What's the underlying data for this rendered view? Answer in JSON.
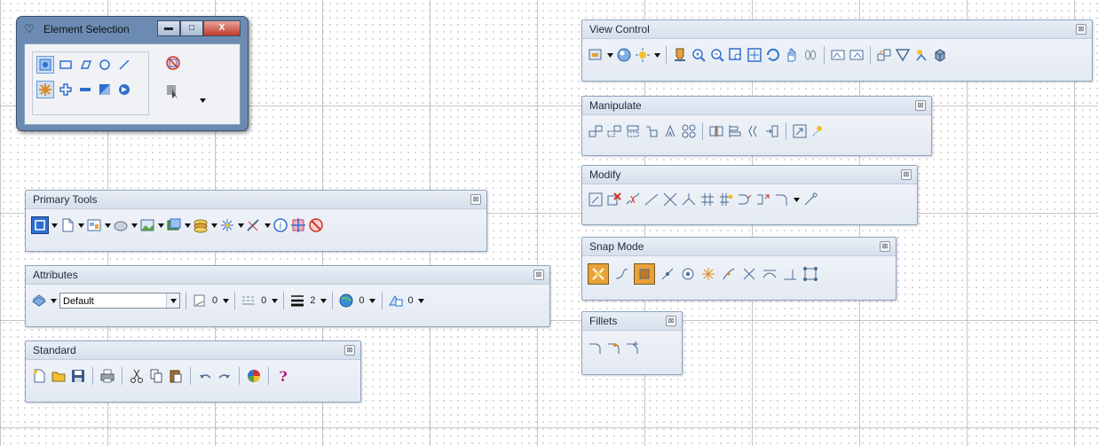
{
  "element_selection": {
    "title": "Element Selection",
    "minimize_icon": "minimize-icon",
    "maximize_icon": "maximize-icon",
    "close_label": "X"
  },
  "view_control": {
    "title": "View Control"
  },
  "manipulate": {
    "title": "Manipulate"
  },
  "modify": {
    "title": "Modify"
  },
  "snap_mode": {
    "title": "Snap Mode"
  },
  "fillets": {
    "title": "Fillets"
  },
  "primary_tools": {
    "title": "Primary Tools"
  },
  "attributes": {
    "title": "Attributes",
    "level_value": "Default",
    "color_value": "0",
    "style_value": "0",
    "weight_value": "2",
    "transparency_value": "0",
    "priority_value": "0"
  },
  "standard": {
    "title": "Standard"
  },
  "colors": {
    "toolbar_border": "#8ea4c0",
    "window_frame": "#6b8bb3",
    "accent_blue": "#2f6fcf",
    "accent_red": "#d0342c"
  }
}
